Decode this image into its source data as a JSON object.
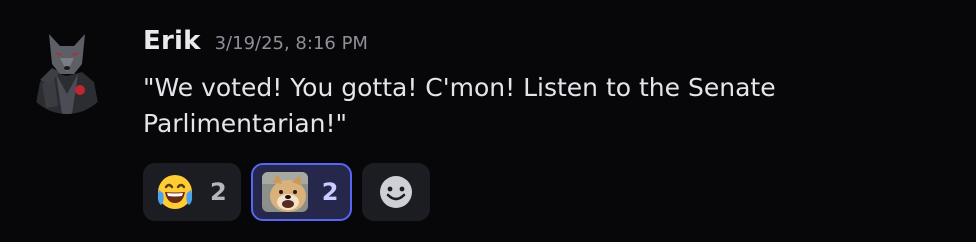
{
  "message": {
    "username": "Erik",
    "timestamp": "3/19/25, 8:16 PM",
    "text": "\"We voted! You gotta! C'mon! Listen to the Senate Parlimentarian!\""
  },
  "reactions": [
    {
      "icon": "joy-emoji-icon",
      "count": "2",
      "active": false
    },
    {
      "icon": "dog-custom-emoji-icon",
      "count": "2",
      "active": true
    }
  ],
  "add_reaction": {
    "icon": "smiley-face-icon"
  },
  "colors": {
    "background": "#070709",
    "active_border": "#5865f2",
    "active_background": "#25284a",
    "reaction_background": "#1c1d22"
  }
}
